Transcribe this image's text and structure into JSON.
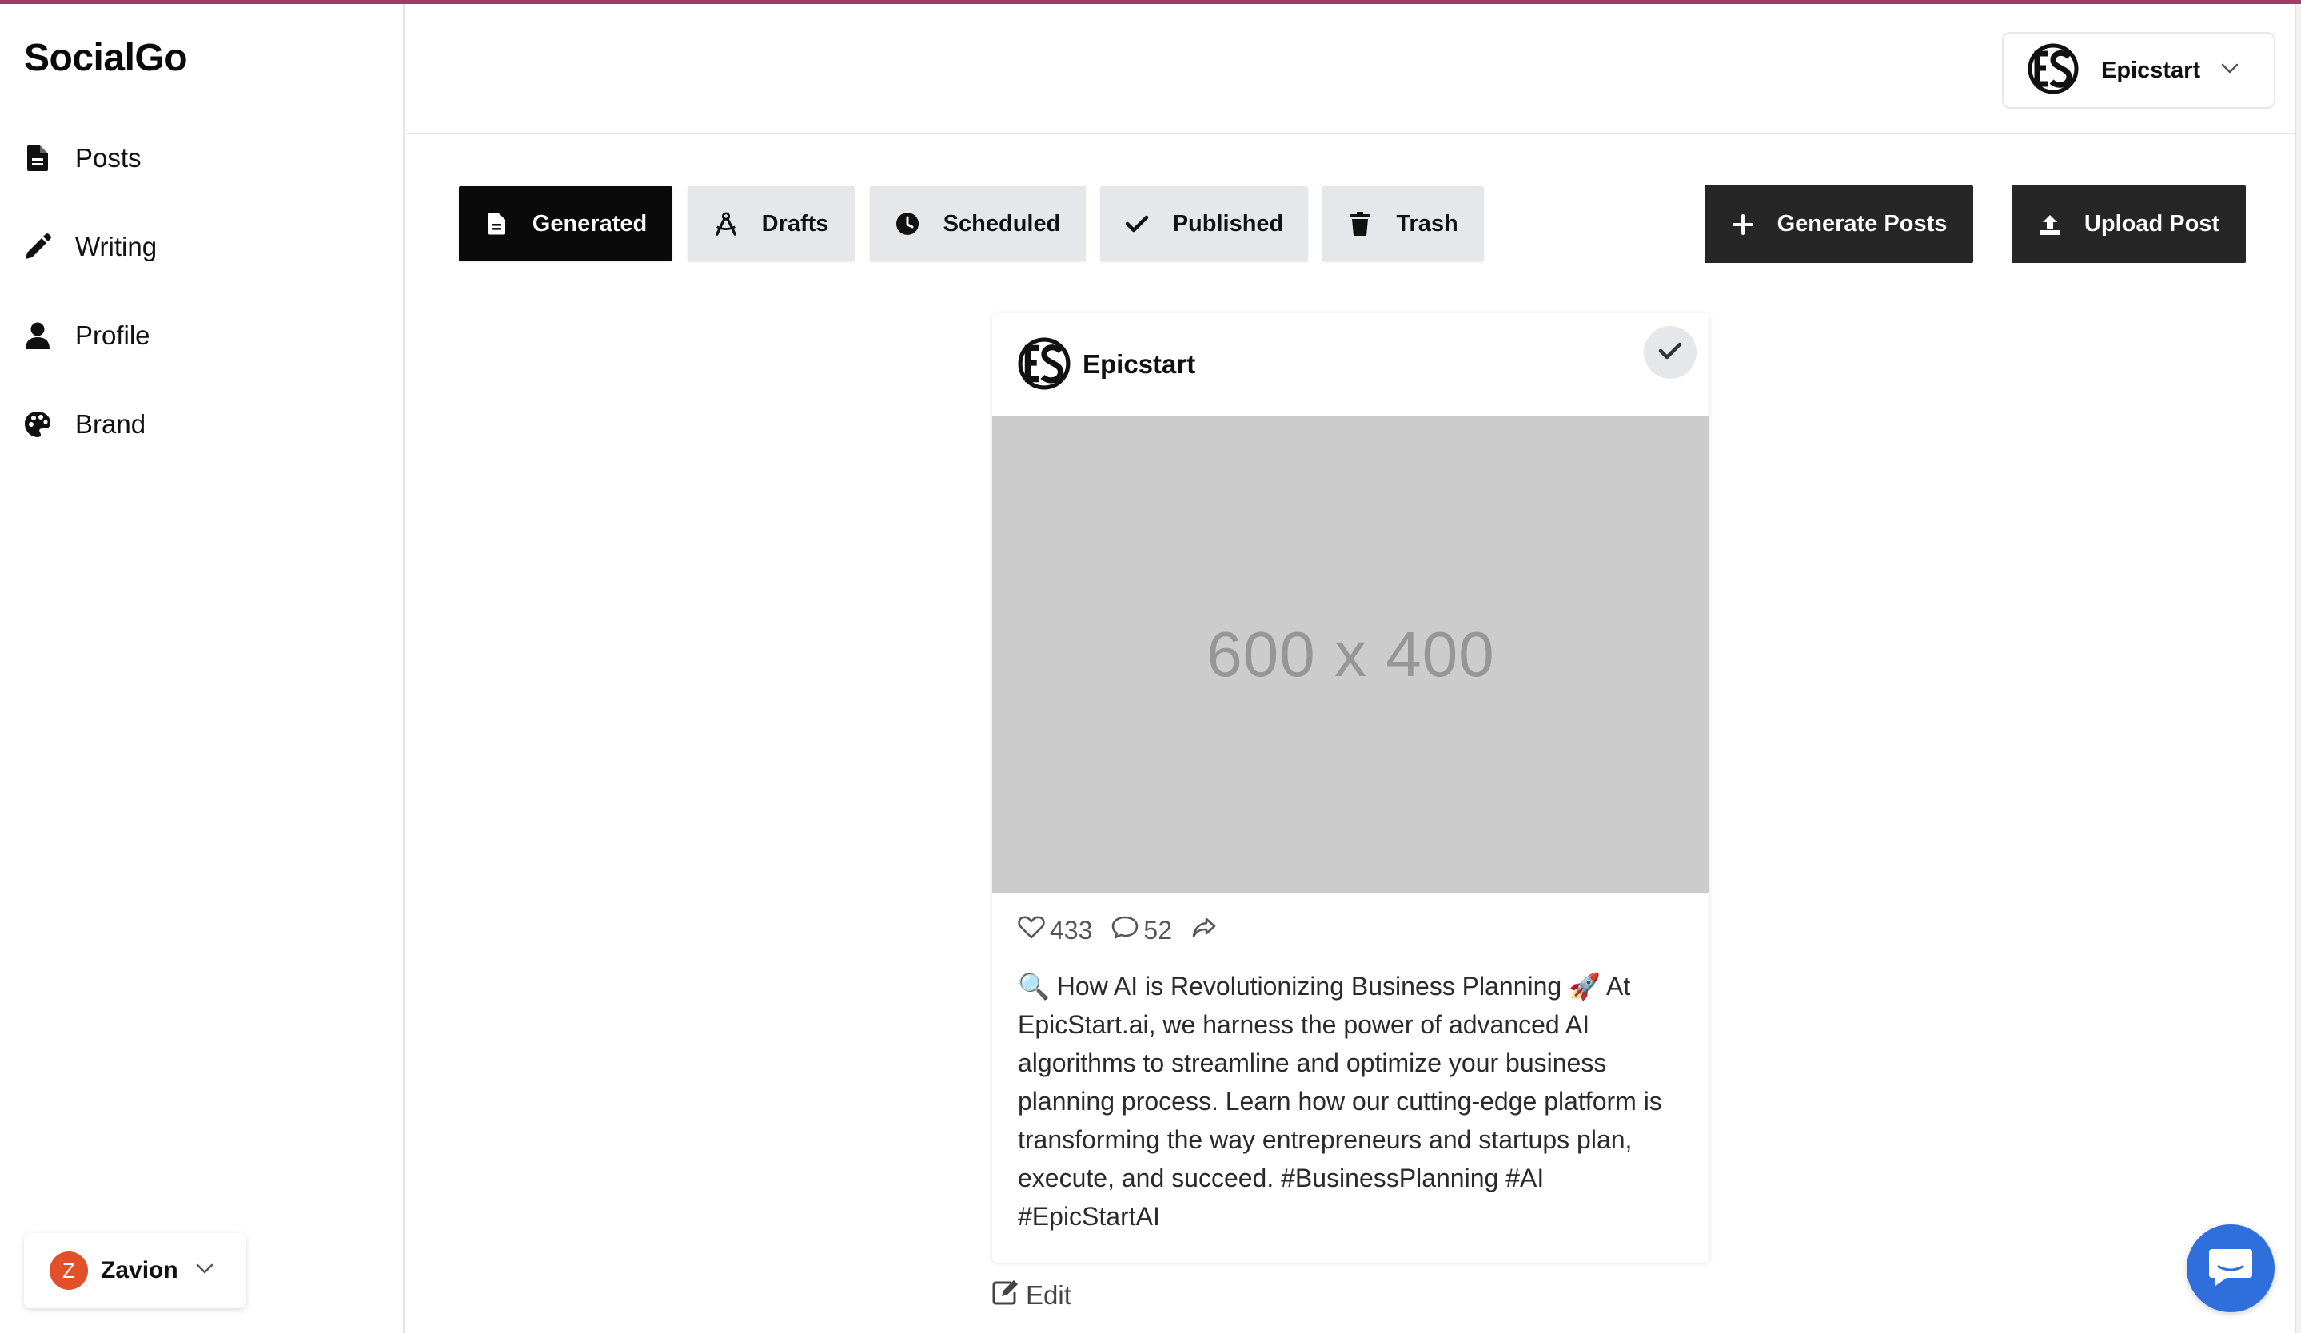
{
  "app": {
    "name": "SocialGo"
  },
  "sidebar": {
    "items": [
      {
        "label": "Posts",
        "icon": "file-icon"
      },
      {
        "label": "Writing",
        "icon": "pencil-icon"
      },
      {
        "label": "Profile",
        "icon": "user-icon"
      },
      {
        "label": "Brand",
        "icon": "palette-icon"
      }
    ]
  },
  "user": {
    "initial": "Z",
    "name": "Zavion",
    "avatar_color": "#e2502a"
  },
  "header": {
    "account_name": "Epicstart"
  },
  "tabs": [
    {
      "label": "Generated",
      "icon": "file-icon",
      "active": true
    },
    {
      "label": "Drafts",
      "icon": "compass-icon",
      "active": false
    },
    {
      "label": "Scheduled",
      "icon": "clock-icon",
      "active": false
    },
    {
      "label": "Published",
      "icon": "check-icon",
      "active": false
    },
    {
      "label": "Trash",
      "icon": "trash-icon",
      "active": false
    }
  ],
  "actions": {
    "generate_label": "Generate Posts",
    "upload_label": "Upload Post"
  },
  "post": {
    "account": "Epicstart",
    "image_placeholder": "600 x 400",
    "likes": "433",
    "comments": "52",
    "caption": "🔍 How AI is Revolutionizing Business Planning 🚀 At EpicStart.ai, we harness the power of advanced AI algorithms to streamline and optimize your business planning process. Learn how our cutting-edge platform is transforming the way entrepreneurs and startups plan, execute, and succeed. #BusinessPlanning #AI #EpicStartAI",
    "edit_label": "Edit"
  },
  "colors": {
    "accent": "#a23a64",
    "active_tab": "#0a0a0a",
    "inactive_tab": "#e5e7eb",
    "action_button": "#262626",
    "chat_fab": "#2f6fdb"
  }
}
